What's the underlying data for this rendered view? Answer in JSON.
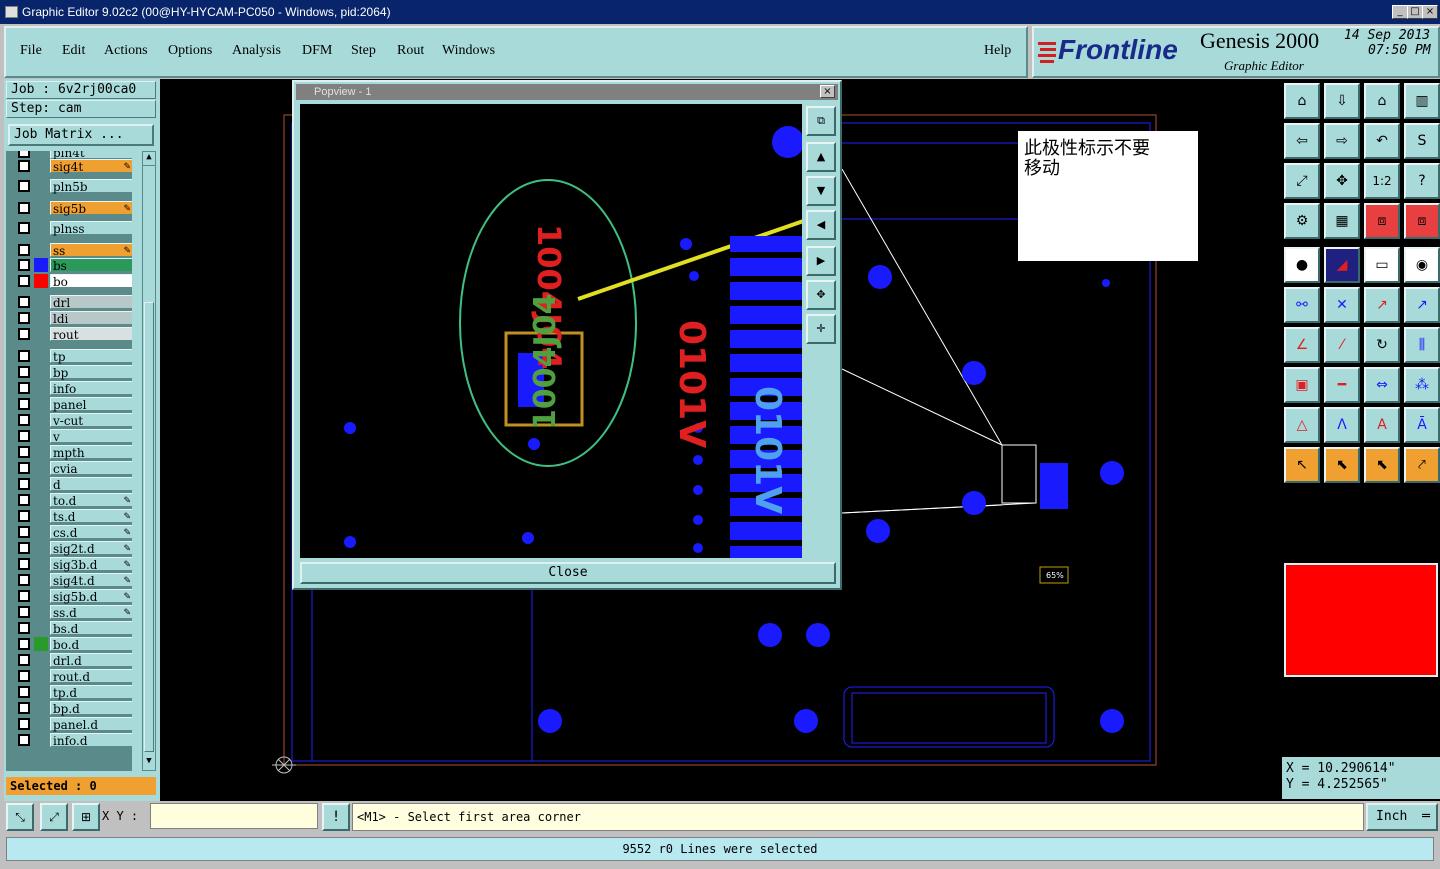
{
  "window": {
    "title": "Graphic Editor 9.02c2 (00@HY-HYCAM-PC050 - Windows, pid:2064)"
  },
  "menu": [
    "File",
    "Edit",
    "Actions",
    "Options",
    "Analysis",
    "DFM",
    "Step",
    "Rout",
    "Windows"
  ],
  "help_label": "Help",
  "brand": {
    "logo": "Frontline",
    "product": "Genesis 2000",
    "subtitle": "Graphic Editor",
    "date": "14 Sep 2013",
    "time": "07:50 PM"
  },
  "job": {
    "job_label": "Job : 6v2rj00ca0",
    "step_label": "Step: cam",
    "matrix_button": "Job Matrix ..."
  },
  "layers": [
    {
      "name": "pln4t",
      "color": "#a8dada",
      "swatch": ""
    },
    {
      "name": "sig4t",
      "color": "#f0a030",
      "swatch": "",
      "mark": true
    },
    {
      "name": "pln5b",
      "color": "#a8dada",
      "swatch": ""
    },
    {
      "name": "sig5b",
      "color": "#f0a030",
      "swatch": "",
      "mark": true
    },
    {
      "name": "plnss",
      "color": "#a8dada",
      "swatch": ""
    },
    {
      "name": "ss",
      "color": "#f0a030",
      "swatch": "",
      "mark": true
    },
    {
      "name": "bs",
      "color": "#2a9a5a",
      "swatch": "#1a1aff"
    },
    {
      "name": "bo",
      "color": "#ffffff",
      "swatch": "#ff0000"
    },
    {
      "name": "drl",
      "color": "#b8c8c8",
      "swatch": ""
    },
    {
      "name": "ldi",
      "color": "#b8c8c8",
      "swatch": ""
    },
    {
      "name": "rout",
      "color": "#d8e0e0",
      "swatch": ""
    },
    {
      "name": "tp",
      "color": "#a8dada",
      "swatch": ""
    },
    {
      "name": "bp",
      "color": "#a8dada",
      "swatch": ""
    },
    {
      "name": "info",
      "color": "#a8dada",
      "swatch": ""
    },
    {
      "name": "panel",
      "color": "#a8dada",
      "swatch": ""
    },
    {
      "name": "v-cut",
      "color": "#a8dada",
      "swatch": ""
    },
    {
      "name": "v",
      "color": "#a8dada",
      "swatch": ""
    },
    {
      "name": "mpth",
      "color": "#a8dada",
      "swatch": ""
    },
    {
      "name": "cvia",
      "color": "#a8dada",
      "swatch": ""
    },
    {
      "name": "d",
      "color": "#a8dada",
      "swatch": ""
    },
    {
      "name": "to.d",
      "color": "#a8dada",
      "swatch": "",
      "mark": true
    },
    {
      "name": "ts.d",
      "color": "#a8dada",
      "swatch": "",
      "mark": true
    },
    {
      "name": "cs.d",
      "color": "#a8dada",
      "swatch": "",
      "mark": true
    },
    {
      "name": "sig2t.d",
      "color": "#a8dada",
      "swatch": "",
      "mark": true
    },
    {
      "name": "sig3b.d",
      "color": "#a8dada",
      "swatch": "",
      "mark": true
    },
    {
      "name": "sig4t.d",
      "color": "#a8dada",
      "swatch": "",
      "mark": true
    },
    {
      "name": "sig5b.d",
      "color": "#a8dada",
      "swatch": "",
      "mark": true
    },
    {
      "name": "ss.d",
      "color": "#a8dada",
      "swatch": "",
      "mark": true
    },
    {
      "name": "bs.d",
      "color": "#a8dada",
      "swatch": ""
    },
    {
      "name": "bo.d",
      "color": "#a8dada",
      "swatch": "#2a9a2a"
    },
    {
      "name": "drl.d",
      "color": "#a8dada",
      "swatch": ""
    },
    {
      "name": "rout.d",
      "color": "#a8dada",
      "swatch": ""
    },
    {
      "name": "tp.d",
      "color": "#a8dada",
      "swatch": ""
    },
    {
      "name": "bp.d",
      "color": "#a8dada",
      "swatch": ""
    },
    {
      "name": "panel.d",
      "color": "#a8dada",
      "swatch": ""
    },
    {
      "name": "info.d",
      "color": "#a8dada",
      "swatch": ""
    }
  ],
  "selected_label": "Selected : 0",
  "popview": {
    "title": "Popview - 1",
    "close_label": "Close",
    "annotation": "此极性标示不要\n移动",
    "mark_red_1": "1004J04",
    "mark_red_2": "0101V",
    "mark_blue": "0101V",
    "mark_green": "1004J04"
  },
  "coords": {
    "x": "X = 10.290614\"",
    "y": "Y = 4.252565\""
  },
  "status": {
    "xy_label": "X Y :",
    "xy_value": "",
    "prompt": "<M1> - Select first area corner",
    "units": "Inch",
    "message": "9552 r0 Lines were selected"
  },
  "chip_label": "65%"
}
